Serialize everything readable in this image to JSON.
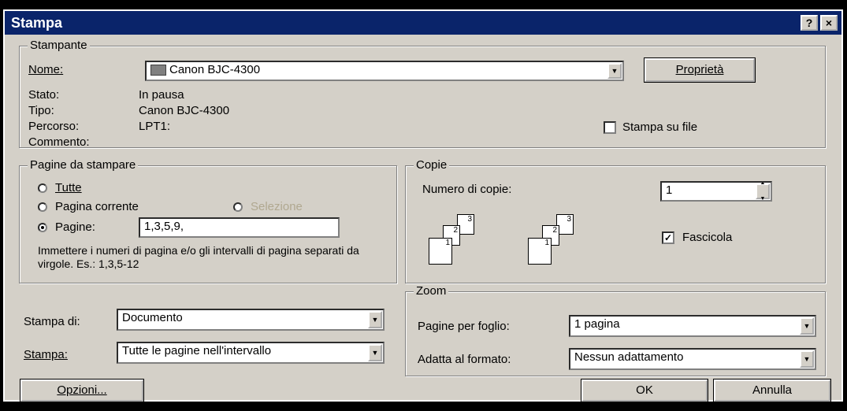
{
  "title": "Stampa",
  "title_buttons": {
    "help": "?",
    "close": "×"
  },
  "printer": {
    "group_label": "Stampante",
    "name_label": "Nome:",
    "name_value": "Canon BJC-4300",
    "properties_button": "Proprietà",
    "status_label": "Stato:",
    "status_value": "In pausa",
    "type_label": "Tipo:",
    "type_value": "Canon BJC-4300",
    "path_label": "Percorso:",
    "path_value": "LPT1:",
    "comment_label": "Commento:",
    "print_to_file_label": "Stampa su file",
    "print_to_file_checked": false
  },
  "range": {
    "group_label": "Pagine da stampare",
    "all_label": "Tutte",
    "current_label": "Pagina corrente",
    "selection_label": "Selezione",
    "pages_label": "Pagine:",
    "pages_value": "1,3,5,9,",
    "hint": "Immettere i numeri di pagina e/o gli intervalli di pagina separati da virgole. Es.: 1,3,5-12",
    "selected": "pages"
  },
  "copies": {
    "group_label": "Copie",
    "count_label": "Numero di copie:",
    "count_value": "1",
    "collate_label": "Fascicola",
    "collate_checked": true,
    "page_numbers": [
      "1",
      "2",
      "3"
    ]
  },
  "print_what": {
    "label": "Stampa di:",
    "value": "Documento"
  },
  "print": {
    "label": "Stampa:",
    "value": "Tutte le pagine nell'intervallo"
  },
  "zoom": {
    "group_label": "Zoom",
    "pages_per_sheet_label": "Pagine per foglio:",
    "pages_per_sheet_value": "1 pagina",
    "scale_label": "Adatta al formato:",
    "scale_value": "Nessun adattamento"
  },
  "buttons": {
    "options": "Opzioni...",
    "ok": "OK",
    "cancel": "Annulla"
  }
}
